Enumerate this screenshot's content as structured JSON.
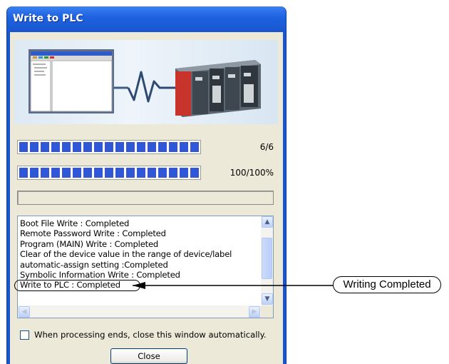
{
  "window": {
    "title": "Write to PLC"
  },
  "progress": [
    {
      "value": 1.0,
      "text": "6/6"
    },
    {
      "value": 1.0,
      "text": "100/100%"
    }
  ],
  "log": {
    "lines": [
      "Boot File Write : Completed",
      "Remote Password Write : Completed",
      "Program (MAIN) Write : Completed",
      "Clear of the device value in the range of device/label",
      "automatic-assign setting :Completed",
      "Symbolic Information Write : Completed",
      "Write to PLC : Completed"
    ]
  },
  "auto_close": {
    "label": "When processing ends, close this window automatically.",
    "checked": false
  },
  "buttons": {
    "close": "Close"
  },
  "callout": {
    "text": "Writing Completed"
  },
  "icons": {
    "scroll_up": "chevron-up-icon",
    "scroll_down": "chevron-down-icon",
    "scroll_left": "chevron-left-icon",
    "scroll_right": "chevron-right-icon"
  },
  "colors": {
    "title_bar": "#1a55cf",
    "progress_fill": "#2f57d6",
    "dialog_bg": "#ece9d8"
  }
}
